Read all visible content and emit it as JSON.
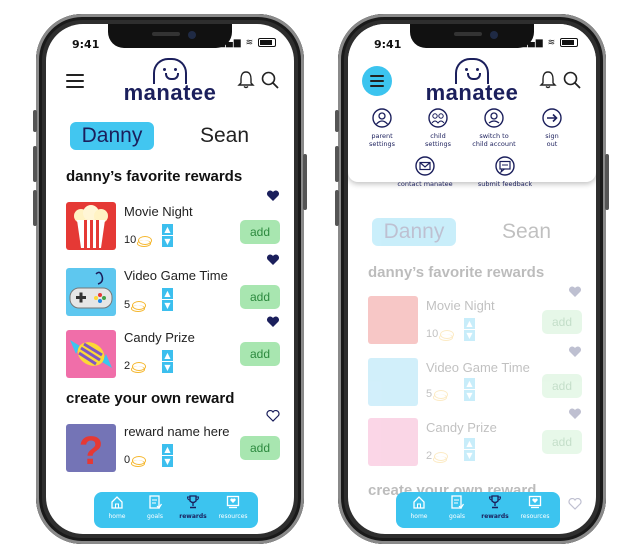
{
  "status": {
    "time": "9:41"
  },
  "brand": {
    "name": "manatee"
  },
  "children": {
    "active": "Danny",
    "other": "Sean"
  },
  "favorites": {
    "title": "danny’s favorite rewards",
    "items": [
      {
        "name": "Movie Night",
        "cost": "10",
        "icon": "popcorn-icon"
      },
      {
        "name": "Video Game Time",
        "cost": "5",
        "icon": "game-controller-icon"
      },
      {
        "name": "Candy Prize",
        "cost": "2",
        "icon": "candy-icon"
      }
    ]
  },
  "custom": {
    "title": "create your own reward",
    "placeholder_name": "reward name here",
    "cost": "0",
    "icon": "question-mark-icon"
  },
  "actions": {
    "add_label": "add"
  },
  "nav": {
    "items": [
      {
        "label": "home",
        "icon": "home-icon"
      },
      {
        "label": "goals",
        "icon": "goals-icon"
      },
      {
        "label": "rewards",
        "icon": "trophy-icon",
        "active": true
      },
      {
        "label": "resources",
        "icon": "resources-icon"
      }
    ]
  },
  "menu": {
    "items": [
      {
        "label_1": "parent",
        "label_2": "settings",
        "icon": "parent-user-icon"
      },
      {
        "label_1": "child",
        "label_2": "settings",
        "icon": "child-user-icon"
      },
      {
        "label_1": "switch to",
        "label_2": "child account",
        "icon": "switch-account-icon"
      },
      {
        "label_1": "sign",
        "label_2": "out",
        "icon": "sign-out-icon"
      },
      {
        "label_1": "contact manatee",
        "label_2": "",
        "icon": "mail-icon"
      },
      {
        "label_1": "submit feedback",
        "label_2": "",
        "icon": "feedback-icon"
      }
    ]
  },
  "colors": {
    "accent": "#3cc4ef",
    "navy": "#1b1f5c",
    "add_bg": "#a8e6b0",
    "add_text": "#2d8a3f"
  }
}
